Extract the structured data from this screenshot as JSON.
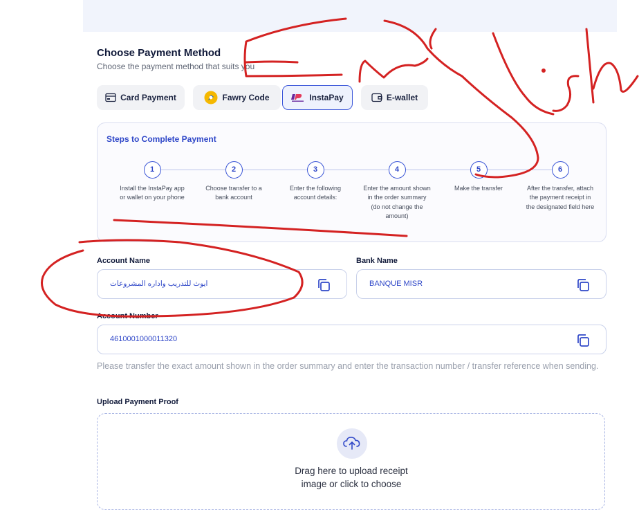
{
  "payment": {
    "title": "Choose Payment Method",
    "subtitle": "Choose the payment method that suits you",
    "methods": [
      {
        "label": "Card Payment",
        "icon": "card-icon"
      },
      {
        "label": "Fawry Code",
        "icon": "fawry-icon"
      },
      {
        "label": "InstaPay",
        "icon": "instapay-icon",
        "selected": true
      },
      {
        "label": "E-wallet",
        "icon": "wallet-icon"
      }
    ]
  },
  "steps": {
    "title": "Steps to Complete Payment",
    "items": [
      {
        "number": "1",
        "text": "Install the InstaPay app or wallet on your phone"
      },
      {
        "number": "2",
        "text": "Choose transfer to a bank account"
      },
      {
        "number": "3",
        "text": "Enter the following account details:"
      },
      {
        "number": "4",
        "text": "Enter the amount shown in the order summary (do not change the amount)"
      },
      {
        "number": "5",
        "text": "Make the transfer"
      },
      {
        "number": "6",
        "text": "After the transfer, attach the payment receipt in the designated field here"
      }
    ]
  },
  "account": {
    "name_label": "Account Name",
    "name_value": "ايوث للتدريب واداره المشروعات",
    "bank_label": "Bank Name",
    "bank_value": "BANQUE MISR",
    "number_label": "Account Number",
    "number_value": "4610001000011320"
  },
  "note": "Please transfer the exact amount shown in the order summary and enter the transaction number / transfer reference when sending.",
  "upload": {
    "label": "Upload Payment Proof",
    "drop_text": "Drag here to upload receipt image or click to choose"
  },
  "colors": {
    "accent": "#2f47c8",
    "annotation": "#d42222"
  }
}
